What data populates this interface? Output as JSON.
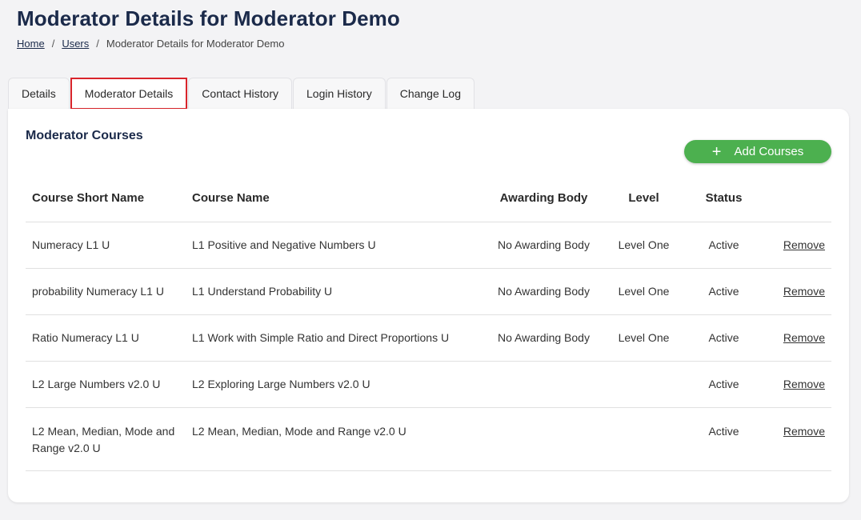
{
  "page": {
    "title": "Moderator Details for Moderator Demo"
  },
  "breadcrumb": {
    "home": "Home",
    "sep1": "/",
    "users": "Users",
    "sep2": "/",
    "current": "Moderator Details for Moderator Demo"
  },
  "tabs": [
    {
      "label": "Details"
    },
    {
      "label": "Moderator Details",
      "active": true
    },
    {
      "label": "Contact History"
    },
    {
      "label": "Login History"
    },
    {
      "label": "Change Log"
    }
  ],
  "section": {
    "title": "Moderator Courses",
    "add_button": "Add Courses",
    "add_icon": "plus-icon"
  },
  "table": {
    "headers": [
      "Course Short Name",
      "Course Name",
      "Awarding Body",
      "Level",
      "Status",
      ""
    ],
    "rows": [
      {
        "short": "Numeracy L1 U",
        "name": "L1 Positive and Negative Numbers U",
        "body": "No Awarding Body",
        "level": "Level One",
        "status": "Active",
        "action": "Remove"
      },
      {
        "short": "probability Numeracy L1 U",
        "name": "L1 Understand Probability U",
        "body": "No Awarding Body",
        "level": "Level One",
        "status": "Active",
        "action": "Remove"
      },
      {
        "short": "Ratio Numeracy L1 U",
        "name": "L1 Work with Simple Ratio and Direct Proportions U",
        "body": "No Awarding Body",
        "level": "Level One",
        "status": "Active",
        "action": "Remove"
      },
      {
        "short": "L2 Large Numbers v2.0 U",
        "name": "L2 Exploring Large Numbers v2.0 U",
        "body": "",
        "level": "",
        "status": "Active",
        "action": "Remove"
      },
      {
        "short": "L2 Mean, Median, Mode and Range v2.0 U",
        "name": "L2 Mean, Median, Mode and Range v2.0 U",
        "body": "",
        "level": "",
        "status": "Active",
        "action": "Remove"
      }
    ]
  },
  "colors": {
    "title": "#1b2a4a",
    "add_button": "#4cb04f",
    "active_tab_border": "#d9242b",
    "background": "#f3f3f5"
  }
}
